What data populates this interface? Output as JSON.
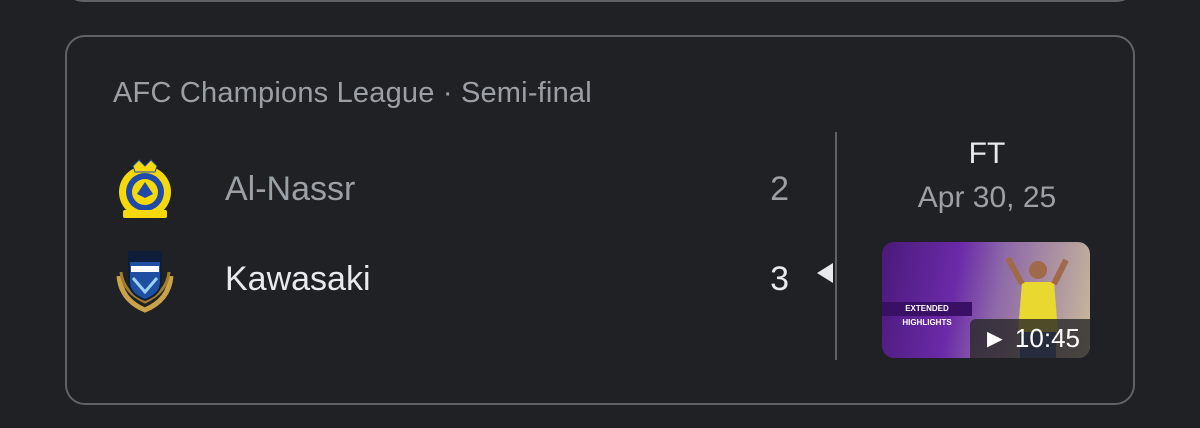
{
  "match": {
    "league": "AFC Champions League · Semi-final",
    "home": {
      "name": "Al-Nassr",
      "score": "2",
      "logo_icon": "al-nassr-crest-icon"
    },
    "away": {
      "name": "Kawasaki",
      "score": "3",
      "logo_icon": "kawasaki-frontale-crest-icon"
    },
    "status": "FT",
    "date": "Apr 30, 25",
    "highlight": {
      "duration": "► 10:45",
      "banner": "EXTENDED HIGHLIGHTS"
    }
  },
  "colors": {
    "background": "#202124",
    "border": "#5f6368",
    "primary_text": "#e8eaed",
    "secondary_text": "#9aa0a6"
  }
}
